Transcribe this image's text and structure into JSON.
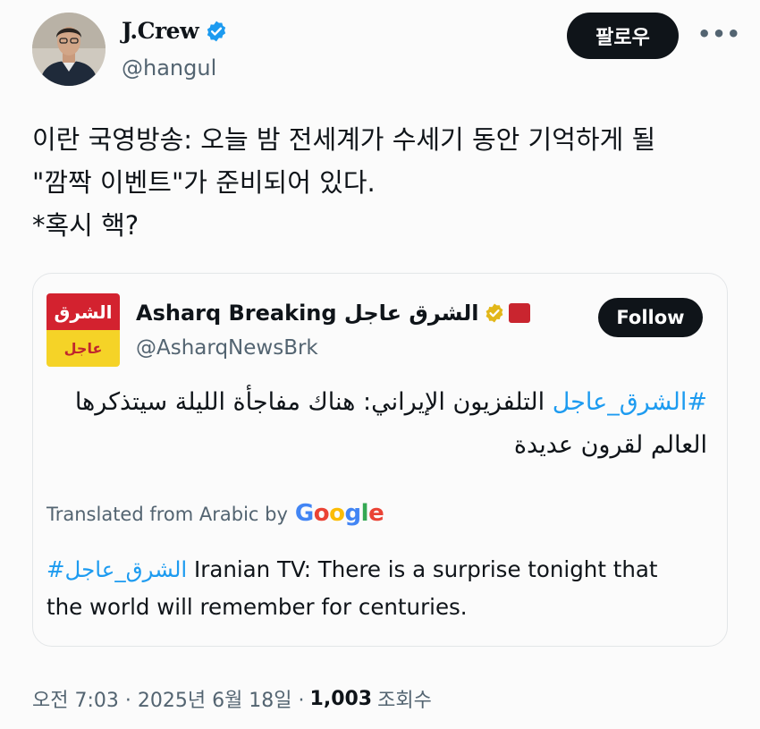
{
  "author": {
    "name": "J.Crew",
    "handle": "@hangul",
    "follow_label": "팔로우",
    "more_label": "•••"
  },
  "tweet": {
    "text": "이란 국영방송: 오늘 밤 전세계가 수세기 동안 기억하게 될\n\"깜짝 이벤트\"가 준비되어 있다.\n*혹시 핵?"
  },
  "quote": {
    "logo_top": "الشرق",
    "logo_bottom": "عاجل",
    "name": "Asharq Breaking الشرق عاجل",
    "handle": "@AsharqNewsBrk",
    "follow_label": "Follow",
    "arabic_hashtag": "#الشرق_عاجل",
    "arabic_text": " التلفزيون الإيراني: هناك مفاجأة الليلة سيتذكرها العالم لقرون عديدة",
    "translated_label": "Translated from Arabic by",
    "google_letters": [
      "G",
      "o",
      "o",
      "g",
      "l",
      "e"
    ],
    "translation_hashtag": "#الشرق_عاجل",
    "translation_text": " Iranian TV: There is a surprise tonight that the world will remember for centuries."
  },
  "meta": {
    "time": "오전 7:03 · 2025년 6월 18일 ·",
    "views_count": "1,003",
    "views_label": "조회수"
  },
  "colors": {
    "link": "#1d9bf0",
    "verified_blue": "#1d9bf0",
    "gold_badge": "#e2b719",
    "asharq_red": "#d3222f",
    "asharq_yellow": "#f5d327"
  }
}
